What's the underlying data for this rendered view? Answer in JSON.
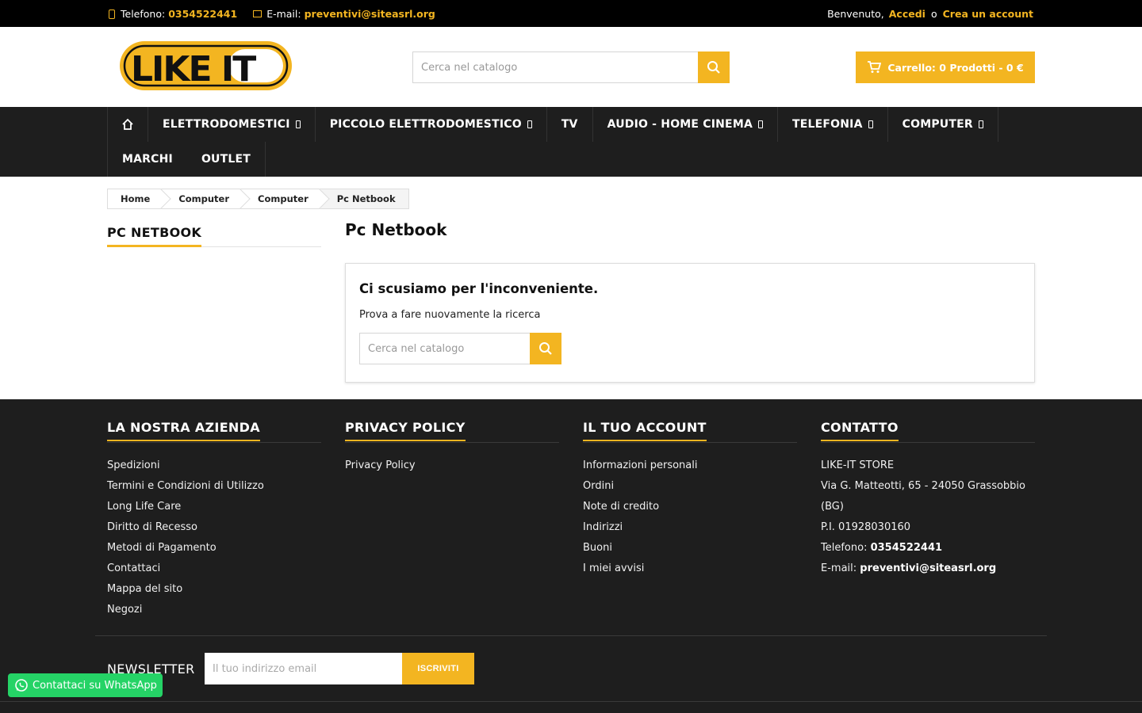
{
  "topbar": {
    "phone_label": "Telefono:",
    "phone_value": "0354522441",
    "email_label": "E-mail:",
    "email_value": "preventivi@siteasrl.org",
    "welcome": "Benvenuto,",
    "login": "Accedi",
    "or": "o",
    "register": "Crea un account"
  },
  "header": {
    "logo_text": "LIKE IT",
    "search_placeholder": "Cerca nel catalogo",
    "cart_label": "Carrello: 0 Prodotti - 0 €"
  },
  "nav": {
    "items": [
      {
        "label": "ELETTRODOMESTICI",
        "has_children": true
      },
      {
        "label": "PICCOLO ELETTRODOMESTICO",
        "has_children": true
      },
      {
        "label": "TV",
        "has_children": false
      },
      {
        "label": "AUDIO - HOME CINEMA",
        "has_children": true
      },
      {
        "label": "TELEFONIA",
        "has_children": true
      },
      {
        "label": "COMPUTER",
        "has_children": true
      },
      {
        "label": "MARCHI",
        "has_children": false
      },
      {
        "label": "OUTLET",
        "has_children": false
      }
    ]
  },
  "breadcrumb": [
    "Home",
    "Computer",
    "Computer",
    "Pc Netbook"
  ],
  "sidebar": {
    "title": "PC NETBOOK"
  },
  "main": {
    "title": "Pc Netbook",
    "no_results_title": "Ci scusiamo per l'inconveniente.",
    "no_results_text": "Prova a fare nuovamente la ricerca",
    "search_placeholder": "Cerca nel catalogo"
  },
  "footer": {
    "company": {
      "title": "LA NOSTRA AZIENDA",
      "links": [
        "Spedizioni",
        "Termini e Condizioni di Utilizzo",
        "Long Life Care",
        "Diritto di Recesso",
        "Metodi di Pagamento",
        "Contattaci",
        "Mappa del sito",
        "Negozi"
      ]
    },
    "privacy": {
      "title": "PRIVACY POLICY",
      "links": [
        "Privacy Policy"
      ]
    },
    "account": {
      "title": "IL TUO ACCOUNT",
      "links": [
        "Informazioni personali",
        "Ordini",
        "Note di credito",
        "Indirizzi",
        "Buoni",
        "I miei avvisi"
      ]
    },
    "contact": {
      "title": "CONTATTO",
      "store": "LIKE-IT STORE",
      "address": "Via G. Matteotti, 65 - 24050 Grassobbio",
      "address2": "(BG)",
      "vat": "P.I. 01928030160",
      "phone_label": "Telefono:",
      "phone": "0354522441",
      "email_label": "E-mail:",
      "email": "preventivi@siteasrl.org"
    },
    "newsletter": {
      "label": "NEWSLETTER",
      "placeholder": "Il tuo indirizzo email",
      "button": "ISCRIVITI"
    }
  },
  "whatsapp": {
    "label": "Contattaci su WhatsApp"
  },
  "colors": {
    "accent": "#f3b521",
    "dark": "#1e1e1e",
    "topbar": "#000000",
    "whatsapp": "#25d366"
  }
}
